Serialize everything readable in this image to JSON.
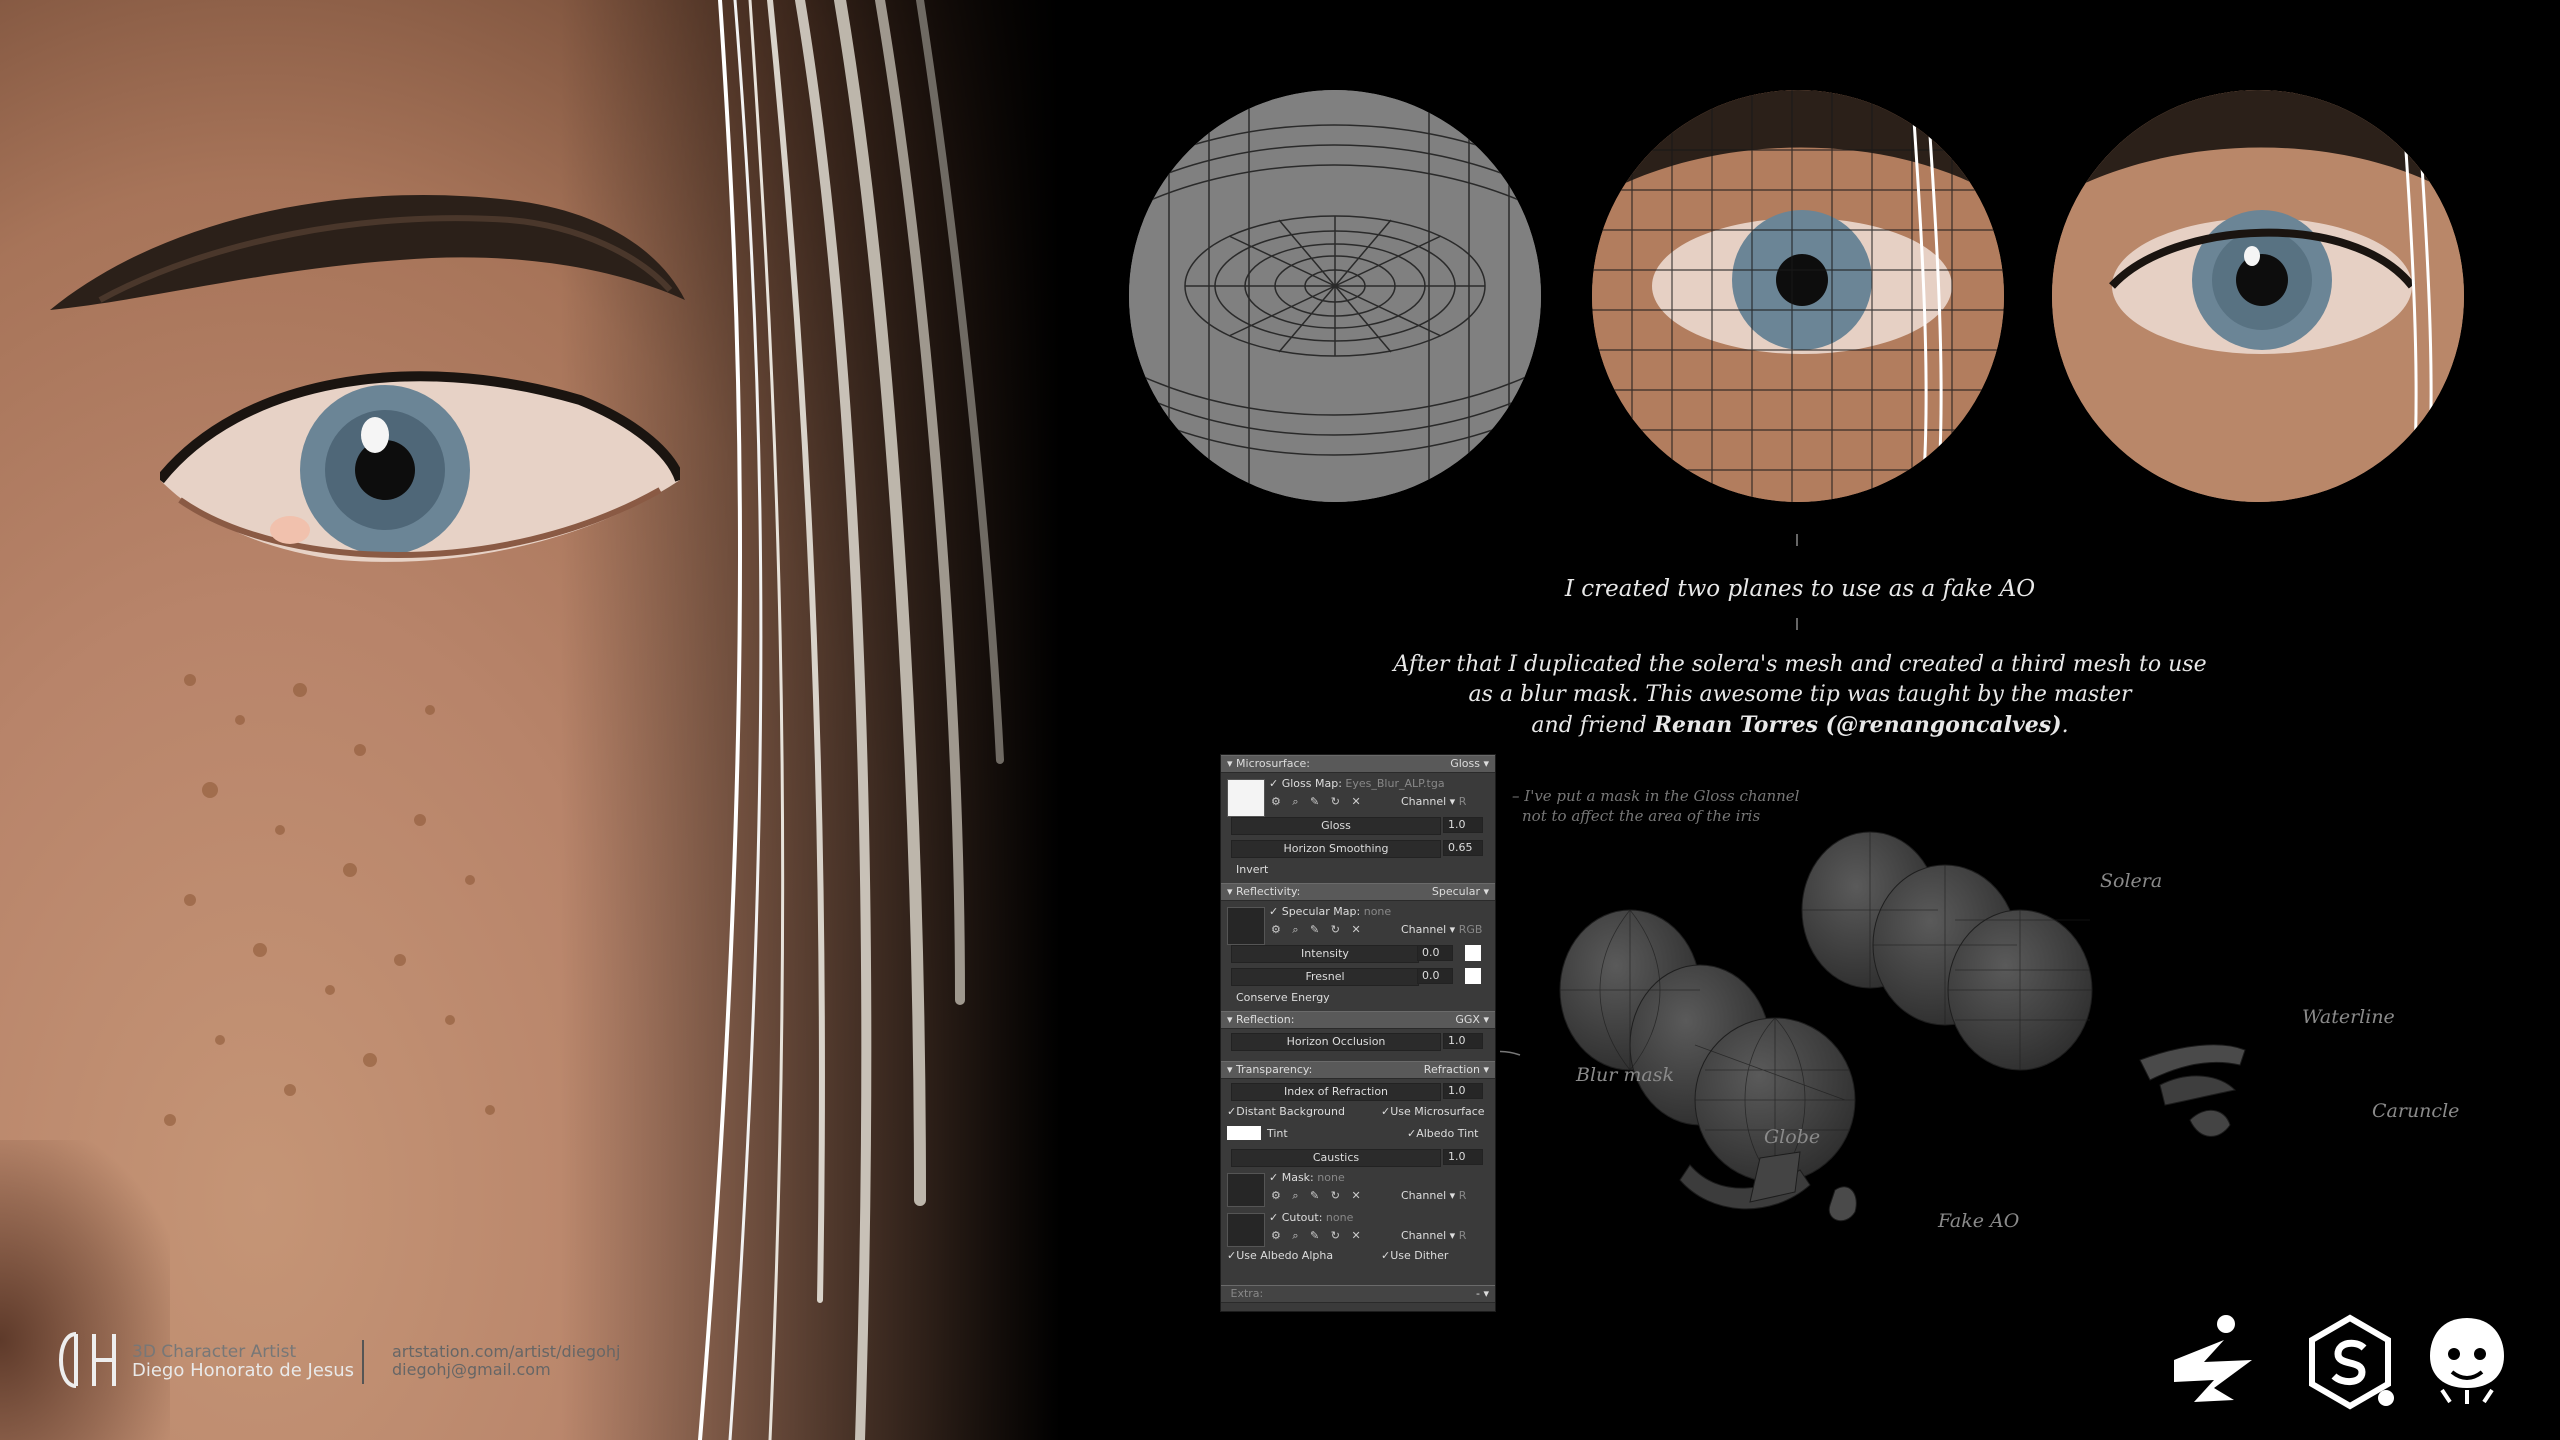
{
  "credits": {
    "role": "3D Character Artist",
    "name": "Diego Honorato de Jesus",
    "url": "artstation.com/artist/diegohj",
    "email": "diegohj@gmail.com"
  },
  "notes": {
    "fake_ao": "I created two planes to use as a fake AO",
    "blur_mask_line1": "After that I duplicated the solera's mesh and created a third mesh to use",
    "blur_mask_line2": "as a blur mask. This awesome tip was taught by the master",
    "blur_mask_line3_pre": "and friend ",
    "blur_mask_line3_bold": "Renan Torres (@renangoncalves)",
    "blur_mask_line3_post": ".",
    "gloss_note_line1": "– I've put a mask in the Gloss channel",
    "gloss_note_line2": "not to affect the area of the iris"
  },
  "mesh_labels": {
    "solera": "Solera",
    "waterline": "Waterline",
    "caruncle": "Caruncle",
    "blur_mask": "Blur mask",
    "globe": "Globe",
    "fake_ao": "Fake AO"
  },
  "panel": {
    "microsurface": {
      "title": "Microsurface:",
      "value": "Gloss"
    },
    "gloss_map": {
      "label": "Gloss Map:",
      "file": "Eyes_Blur_ALP.tga",
      "channel": "Channel",
      "channel_value": "R"
    },
    "gloss": {
      "label": "Gloss",
      "value": "1.0"
    },
    "horizon_smoothing": {
      "label": "Horizon Smoothing",
      "value": "0.65"
    },
    "invert": "Invert",
    "reflectivity": {
      "title": "Reflectivity:",
      "value": "Specular"
    },
    "specular_map": {
      "label": "Specular Map:",
      "file": "none",
      "channel": "Channel",
      "channel_value": "RGB"
    },
    "intensity": {
      "label": "Intensity",
      "value": "0.0"
    },
    "fresnel": {
      "label": "Fresnel",
      "value": "0.0"
    },
    "conserve_energy": "Conserve Energy",
    "reflection": {
      "title": "Reflection:",
      "value": "GGX"
    },
    "horizon_occlusion": {
      "label": "Horizon Occlusion",
      "value": "1.0"
    },
    "transparency": {
      "title": "Transparency:",
      "value": "Refraction"
    },
    "ior": {
      "label": "Index of Refraction",
      "value": "1.0"
    },
    "distant_background": "Distant Background",
    "use_microsurface": "Use Microsurface",
    "tint": "Tint",
    "albedo_tint": "Albedo Tint",
    "caustics": {
      "label": "Caustics",
      "value": "1.0"
    },
    "mask": {
      "label": "Mask:",
      "file": "none",
      "channel": "Channel",
      "channel_value": "R"
    },
    "cutout": {
      "label": "Cutout:",
      "file": "none",
      "channel": "Channel",
      "channel_value": "R"
    },
    "use_albedo_alpha": "Use Albedo Alpha",
    "use_dither": "Use Dither",
    "extra": "Extra:",
    "extra_value": "-"
  },
  "colors": {
    "background": "#000000",
    "skin": "#b8846a",
    "panel": "#3a3a3a",
    "panel_header": "#595959",
    "note_text": "#e8e8e8",
    "label_text": "#8a8a8a"
  },
  "icons": [
    "dh-logo-icon",
    "zbrush-icon",
    "substance-icon",
    "marmoset-icon"
  ]
}
